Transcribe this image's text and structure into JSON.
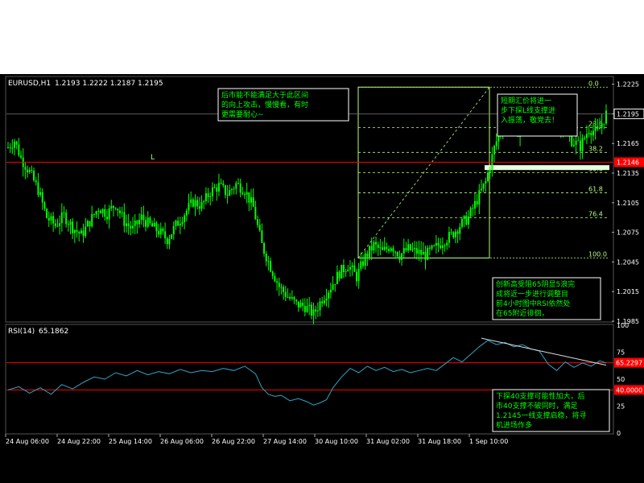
{
  "symbol": "EURUSD,H1",
  "ohlc_header": "1.2193 1.2222 1.2187 1.2195",
  "rsi_header": "RSI(14)",
  "rsi_value_header": "65.1862",
  "top_marker": "L",
  "annotations": {
    "top": "后市能不能满足大于此区间\n的向上攻击，慢慢看，有时\n更需要耐心~",
    "right": "短期汇价将进一\n步下探L线支撑进\n入振荡，敬党去！",
    "middle": "创新高受阻65阴显5浪完\n成将近一步进行调整目\n前4小时图中RSI依然处\n在65附近徘徊，",
    "bottom": "下探40支撑可能性加大，后\n市40支撑不破同时，满足\n1.2145一线支撑启稳，将寻\n机进场作多"
  },
  "colors": {
    "background": "#000000",
    "candle": "#00ff00",
    "grid": "#606060",
    "red_line": "#ff0000",
    "fib": "#b4ff7a",
    "rsi_line": "#2ea6c8",
    "label_box": "#ffffff",
    "price_highlight": "#ff0000",
    "support_bar": "#e8ffe0"
  },
  "chart_data": [
    {
      "type": "candlestick",
      "title": "EURUSD,H1",
      "ylim": [
        1.1985,
        1.2232
      ],
      "yticks": [
        "1.2225",
        "1.2195",
        "1.2165",
        "1.2135",
        "1.2105",
        "1.2075",
        "1.2045",
        "1.2015",
        "1.1985"
      ],
      "xticks": [
        "24 Aug 06:00",
        "24 Aug 22:00",
        "25 Aug 14:00",
        "26 Aug 06:00",
        "26 Aug 22:00",
        "27 Aug 14:00",
        "30 Aug 10:00",
        "31 Aug 02:00",
        "31 Aug 18:00",
        "1 Sep 10:00"
      ],
      "current_price": "1.2195",
      "horizontal_line": {
        "value": 1.2146,
        "label": "1.2146"
      },
      "fibonacci": {
        "levels": [
          "0.0",
          "23.6",
          "38.2",
          "50.0",
          "61.8",
          "76.4",
          "100.0"
        ],
        "high": 1.2222,
        "low": 1.2049
      },
      "close_path": [
        [
          0,
          1.2161
        ],
        [
          3,
          1.2168
        ],
        [
          6,
          1.215
        ],
        [
          10,
          1.2136
        ],
        [
          14,
          1.2118
        ],
        [
          18,
          1.209
        ],
        [
          22,
          1.2082
        ],
        [
          26,
          1.2092
        ],
        [
          30,
          1.208
        ],
        [
          34,
          1.2072
        ],
        [
          38,
          1.2086
        ],
        [
          42,
          1.21
        ],
        [
          46,
          1.2094
        ],
        [
          50,
          1.2104
        ],
        [
          54,
          1.2086
        ],
        [
          58,
          1.2078
        ],
        [
          62,
          1.209
        ],
        [
          66,
          1.2082
        ],
        [
          70,
          1.2076
        ],
        [
          74,
          1.2068
        ],
        [
          78,
          1.2082
        ],
        [
          82,
          1.2094
        ],
        [
          86,
          1.2106
        ],
        [
          90,
          1.2102
        ],
        [
          94,
          1.2116
        ],
        [
          98,
          1.2122
        ],
        [
          102,
          1.2114
        ],
        [
          106,
          1.2124
        ],
        [
          110,
          1.2118
        ],
        [
          114,
          1.21
        ],
        [
          118,
          1.2062
        ],
        [
          122,
          1.204
        ],
        [
          126,
          1.202
        ],
        [
          130,
          1.201
        ],
        [
          134,
          1.2002
        ],
        [
          138,
          1.2
        ],
        [
          142,
          1.1992
        ],
        [
          146,
          1.2008
        ],
        [
          150,
          1.202
        ],
        [
          154,
          1.2034
        ],
        [
          158,
          1.2042
        ],
        [
          162,
          1.203
        ],
        [
          166,
          1.205
        ],
        [
          170,
          1.2062
        ],
        [
          174,
          1.2055
        ],
        [
          178,
          1.2062
        ],
        [
          182,
          1.2052
        ],
        [
          186,
          1.2058
        ],
        [
          190,
          1.2055
        ],
        [
          194,
          1.2052
        ],
        [
          198,
          1.2058
        ],
        [
          202,
          1.2066
        ],
        [
          206,
          1.2072
        ],
        [
          210,
          1.2082
        ],
        [
          214,
          1.209
        ],
        [
          218,
          1.2108
        ],
        [
          222,
          1.2126
        ],
        [
          226,
          1.216
        ],
        [
          230,
          1.2188
        ],
        [
          234,
          1.2182
        ],
        [
          238,
          1.2176
        ],
        [
          242,
          1.219
        ],
        [
          246,
          1.2186
        ],
        [
          250,
          1.2192
        ],
        [
          254,
          1.2188
        ],
        [
          258,
          1.218
        ],
        [
          262,
          1.2168
        ],
        [
          266,
          1.2162
        ],
        [
          270,
          1.218
        ],
        [
          274,
          1.2176
        ],
        [
          278,
          1.2195
        ]
      ]
    },
    {
      "type": "line",
      "title": "RSI(14)",
      "ylim": [
        0,
        100
      ],
      "yticks": [
        "100",
        "75",
        "50",
        "25",
        "0"
      ],
      "levels": [
        {
          "value": 65.2,
          "label": "65.2297"
        },
        {
          "value": 40,
          "label": "40.0000"
        }
      ],
      "trendline_from": [
        220,
        88
      ],
      "trendline_to": [
        278,
        63
      ],
      "series": [
        {
          "values": [
            [
              0,
              40
            ],
            [
              5,
              43
            ],
            [
              10,
              37
            ],
            [
              15,
              42
            ],
            [
              20,
              36
            ],
            [
              25,
              45
            ],
            [
              30,
              41
            ],
            [
              35,
              47
            ],
            [
              40,
              52
            ],
            [
              45,
              50
            ],
            [
              50,
              56
            ],
            [
              55,
              53
            ],
            [
              60,
              58
            ],
            [
              65,
              54
            ],
            [
              70,
              57
            ],
            [
              75,
              55
            ],
            [
              80,
              59
            ],
            [
              85,
              56
            ],
            [
              90,
              58
            ],
            [
              95,
              57
            ],
            [
              100,
              60
            ],
            [
              105,
              58
            ],
            [
              110,
              62
            ],
            [
              115,
              55
            ],
            [
              118,
              42
            ],
            [
              121,
              36
            ],
            [
              124,
              34
            ],
            [
              127,
              35
            ],
            [
              131,
              30
            ],
            [
              135,
              32
            ],
            [
              139,
              29
            ],
            [
              142,
              26
            ],
            [
              145,
              28
            ],
            [
              148,
              31
            ],
            [
              151,
              42
            ],
            [
              155,
              52
            ],
            [
              159,
              60
            ],
            [
              163,
              56
            ],
            [
              167,
              62
            ],
            [
              171,
              58
            ],
            [
              175,
              61
            ],
            [
              179,
              57
            ],
            [
              183,
              59
            ],
            [
              187,
              56
            ],
            [
              191,
              58
            ],
            [
              195,
              60
            ],
            [
              199,
              58
            ],
            [
              203,
              64
            ],
            [
              207,
              70
            ],
            [
              211,
              66
            ],
            [
              215,
              73
            ],
            [
              219,
              80
            ],
            [
              223,
              86
            ],
            [
              227,
              82
            ],
            [
              231,
              84
            ],
            [
              235,
              80
            ],
            [
              239,
              82
            ],
            [
              243,
              78
            ],
            [
              247,
              76
            ],
            [
              251,
              64
            ],
            [
              255,
              58
            ],
            [
              259,
              66
            ],
            [
              263,
              61
            ],
            [
              267,
              65
            ],
            [
              271,
              62
            ],
            [
              275,
              67
            ],
            [
              278,
              65
            ]
          ]
        }
      ]
    }
  ]
}
